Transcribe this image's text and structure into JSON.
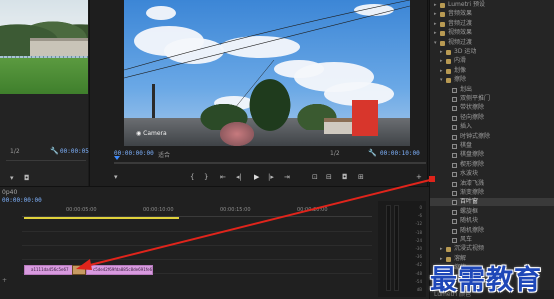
{
  "source_monitor": {
    "zoom_label": "1/2",
    "timecode": "00:00:05:00"
  },
  "program_monitor": {
    "camera_watermark": "Camera",
    "timecode_left": "00:00:00:00",
    "fit_label": "适合",
    "zoom_label": "1/2",
    "timecode_right": "00:00:10:00"
  },
  "effects_panel": {
    "items": [
      {
        "label": "Lumetri 预设",
        "type": "folder",
        "expanded": false,
        "depth": 0
      },
      {
        "label": "音频效果",
        "type": "folder",
        "expanded": false,
        "depth": 0
      },
      {
        "label": "音频过渡",
        "type": "folder",
        "expanded": false,
        "depth": 0
      },
      {
        "label": "视频效果",
        "type": "folder",
        "expanded": false,
        "depth": 0
      },
      {
        "label": "视频过渡",
        "type": "folder",
        "expanded": true,
        "depth": 0
      },
      {
        "label": "3D 运动",
        "type": "folder",
        "expanded": false,
        "depth": 1
      },
      {
        "label": "内滑",
        "type": "folder",
        "expanded": false,
        "depth": 1
      },
      {
        "label": "划像",
        "type": "folder",
        "expanded": false,
        "depth": 1
      },
      {
        "label": "擦除",
        "type": "folder",
        "expanded": true,
        "depth": 1
      },
      {
        "label": "划出",
        "type": "fx",
        "depth": 2
      },
      {
        "label": "双侧平推门",
        "type": "fx",
        "depth": 2
      },
      {
        "label": "带状擦除",
        "type": "fx",
        "depth": 2
      },
      {
        "label": "径向擦除",
        "type": "fx",
        "depth": 2
      },
      {
        "label": "插入",
        "type": "fx",
        "depth": 2
      },
      {
        "label": "时钟式擦除",
        "type": "fx",
        "depth": 2
      },
      {
        "label": "棋盘",
        "type": "fx",
        "depth": 2
      },
      {
        "label": "棋盘擦除",
        "type": "fx",
        "depth": 2
      },
      {
        "label": "楔形擦除",
        "type": "fx",
        "depth": 2
      },
      {
        "label": "水波块",
        "type": "fx",
        "depth": 2
      },
      {
        "label": "油漆飞溅",
        "type": "fx",
        "depth": 2
      },
      {
        "label": "渐变擦除",
        "type": "fx",
        "depth": 2
      },
      {
        "label": "百叶窗",
        "type": "fx",
        "depth": 2,
        "selected": true
      },
      {
        "label": "螺旋框",
        "type": "fx",
        "depth": 2
      },
      {
        "label": "随机块",
        "type": "fx",
        "depth": 2
      },
      {
        "label": "随机擦除",
        "type": "fx",
        "depth": 2
      },
      {
        "label": "风车",
        "type": "fx",
        "depth": 2
      },
      {
        "label": "沉浸式视频",
        "type": "folder",
        "expanded": false,
        "depth": 1
      },
      {
        "label": "溶解",
        "type": "folder",
        "expanded": false,
        "depth": 1
      },
      {
        "label": "缩放",
        "type": "folder",
        "expanded": false,
        "depth": 1
      },
      {
        "label": "页面剥落",
        "type": "folder",
        "expanded": false,
        "depth": 1
      }
    ],
    "footer": "Lumetri 颜色"
  },
  "timeline": {
    "sequence_label": "0p40",
    "timecode": "00:00:00:00",
    "ruler_ticks": [
      "00:00:05:00",
      "00:00:10:00",
      "00:00:15:00",
      "00:00:20:00"
    ],
    "clips": [
      {
        "label": "a1111da456c5e67"
      },
      {
        "label": "c5de42f69fda885c8de691fe62"
      }
    ],
    "meter_levels": [
      "0",
      "-6",
      "-12",
      "-18",
      "-24",
      "-30",
      "-36",
      "-42",
      "-48",
      "-54",
      "dB"
    ]
  },
  "watermark": "最需教育",
  "colors": {
    "accent_blue": "#3d8bff",
    "timecode_blue": "#7fb3ff",
    "clip_pink": "#d89adf",
    "arrow_red": "#e0241b",
    "workarea_yellow": "#e0d23c",
    "watermark_blue": "#1e47b8"
  }
}
